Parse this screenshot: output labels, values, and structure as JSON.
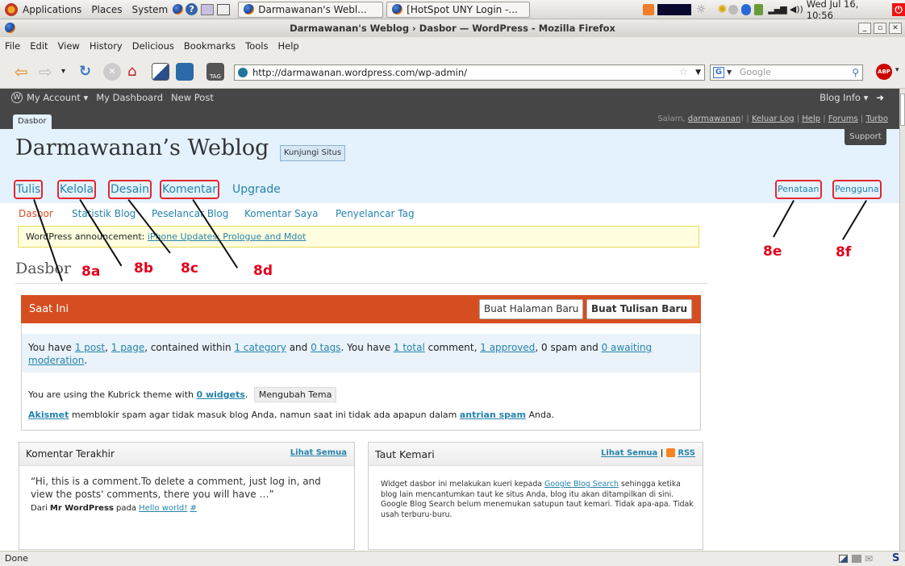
{
  "panel": {
    "menus": [
      "Applications",
      "Places",
      "System"
    ],
    "tasks": [
      "Darmawanan's Webl...",
      "[HotSpot UNY Login -..."
    ],
    "clock": "Wed Jul 16, 10:56"
  },
  "window": {
    "title": "Darmawanan's Weblog › Dasbor — WordPress - Mozilla Firefox"
  },
  "menubar": [
    "File",
    "Edit",
    "View",
    "History",
    "Delicious",
    "Bookmarks",
    "Tools",
    "Help"
  ],
  "navbar": {
    "url": "http://darmawanan.wordpress.com/wp-admin/",
    "search_placeholder": "Google"
  },
  "wpbar": {
    "items": [
      "My Account ▾",
      "My Dashboard",
      "New Post"
    ],
    "blog_info": "Blog Info ▾"
  },
  "wphead": {
    "tab": "Dasbor",
    "greeting_prefix": "Salam, ",
    "user": "darmawanan",
    "links": [
      "Keluar Log",
      "Help",
      "Forums",
      "Turbo"
    ],
    "support": "Support"
  },
  "blog": {
    "title": "Darmawanan’s Weblog",
    "visit": "Kunjungi Situs"
  },
  "mainnav": [
    "Tulis",
    "Kelola",
    "Desain",
    "Komentar",
    "Upgrade"
  ],
  "rightnav": [
    "Penataan",
    "Pengguna"
  ],
  "subnav": [
    "Dasbor",
    "Statistik Blog",
    "Peselancar Blog",
    "Komentar Saya",
    "Penyelancar Tag"
  ],
  "announcement": {
    "prefix": "WordPress announcement: ",
    "link": "iPhone Updates: Prologue and Mdot"
  },
  "page_heading": "Dasbor",
  "annotations": [
    "8a",
    "8b",
    "8c",
    "8d",
    "8e",
    "8f"
  ],
  "saat_ini": {
    "title": "Saat Ini",
    "btn_page": "Buat Halaman Baru",
    "btn_post": "Buat Tulisan Baru",
    "stats": {
      "t1": "You have ",
      "posts": "1 post",
      "t2": ", ",
      "pages": "1 page",
      "t3": ", contained within ",
      "cats": "1 category",
      "t4": " and ",
      "tags": "0 tags",
      "t5": ". You have ",
      "total": "1 total",
      "t6": " comment, ",
      "approved": "1 approved",
      "t7": ", 0 spam and ",
      "awaiting": "0 awaiting moderation",
      "t8": "."
    },
    "theme": {
      "prefix": "You are using the Kubrick theme with ",
      "widgets": "0 widgets",
      "suffix": ".",
      "button": "Mengubah Tema"
    },
    "akismet": {
      "name": "Akismet",
      "t1": " memblokir spam agar tidak masuk blog Anda, namun saat ini tidak ada apapun dalam ",
      "queue": "antrian spam",
      "t2": " Anda."
    }
  },
  "comments_widget": {
    "title": "Komentar Terakhir",
    "link": "Lihat Semua",
    "quote": "“Hi, this is a comment.To delete a comment, just log in, and view the posts' comments, there you will have …”",
    "by_prefix": "Dari ",
    "author": "Mr WordPress",
    "on": " pada ",
    "post": "Hello world!",
    "hash": "#"
  },
  "incoming_widget": {
    "title": "Taut Kemari",
    "link": "Lihat Semua",
    "sep": "|",
    "rss": "RSS",
    "t1": "Widget dasbor ini melakukan kueri kepada ",
    "gbs": "Google Blog Search",
    "t2": " sehingga ketika blog lain mencantumkan taut ke situs Anda, blog itu akan ditampilkan di sini. Google Blog Search belum menemukan satupun taut kemari. Tidak apa-apa. Tidak usah terburu-buru."
  },
  "status": "Done"
}
